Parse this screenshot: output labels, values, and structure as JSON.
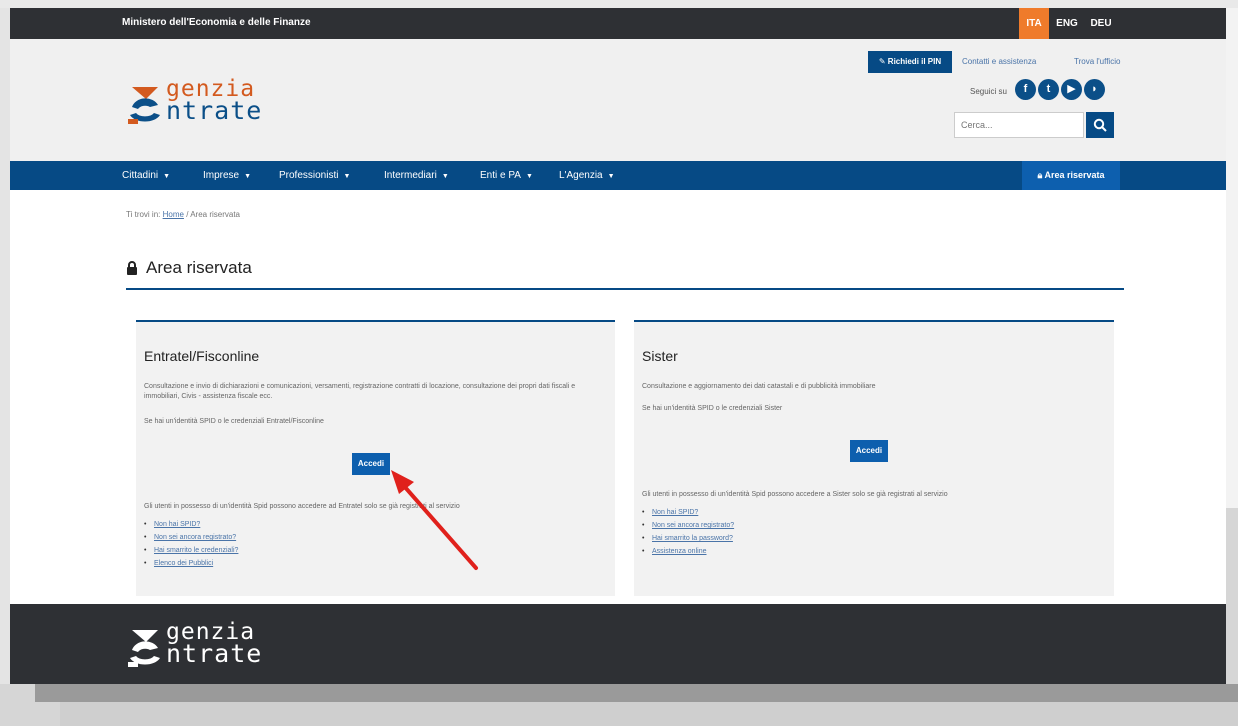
{
  "topbar": {
    "ministry": "Ministero dell'Economia e delle Finanze",
    "languages": [
      "ITA",
      "ENG",
      "DEU"
    ],
    "active_language": "ITA"
  },
  "header": {
    "logo_line1": "genzia",
    "logo_line2": "ntrate",
    "pin_button": "Richiedi il PIN",
    "contatti": "Contatti e assistenza",
    "trova_ufficio": "Trova l'ufficio",
    "seguici": "Seguici su",
    "search_placeholder": "Cerca..."
  },
  "nav": {
    "items": [
      "Cittadini",
      "Imprese",
      "Professionisti",
      "Intermediari",
      "Enti e PA",
      "L'Agenzia"
    ],
    "area_riservata": "Area riservata"
  },
  "breadcrumb": {
    "prefix": "Ti trovi in:",
    "home": "Home",
    "sep": "/",
    "current": "Area riservata"
  },
  "page_title": "Area riservata",
  "cards": {
    "entratel": {
      "title": "Entratel/Fisconline",
      "desc": "Consultazione e invio di dichiarazioni e comunicazioni, versamenti, registrazione contratti di locazione, consultazione dei propri dati fiscali e immobiliari, Civis - assistenza fiscale ecc.",
      "spid": "Se hai un'identità SPID o le credenziali Entratel/Fisconline",
      "button": "Accedi",
      "note": "Gli utenti in possesso di un'identità Spid possono accedere ad Entratel solo se già registrati al servizio",
      "links": [
        "Non hai SPID?",
        "Non sei ancora registrato?",
        "Hai smarrito le credenziali?",
        "Elenco dei Pubblici"
      ]
    },
    "sister": {
      "title": "Sister",
      "desc": "Consultazione e aggiornamento dei dati catastali e di pubblicità immobiliare",
      "spid": "Se hai un'identità SPID o le credenziali Sister",
      "button": "Accedi",
      "note": "Gli utenti in possesso di un'identità Spid possono accedere a Sister solo se già registrati al servizio",
      "links": [
        "Non hai SPID?",
        "Non sei ancora registrato?",
        "Hai smarrito la password?",
        "Assistenza online"
      ]
    }
  },
  "colors": {
    "primary": "#064a85",
    "accent": "#ef7b2b",
    "dark": "#2e3034",
    "annotation": "#e0211c"
  }
}
